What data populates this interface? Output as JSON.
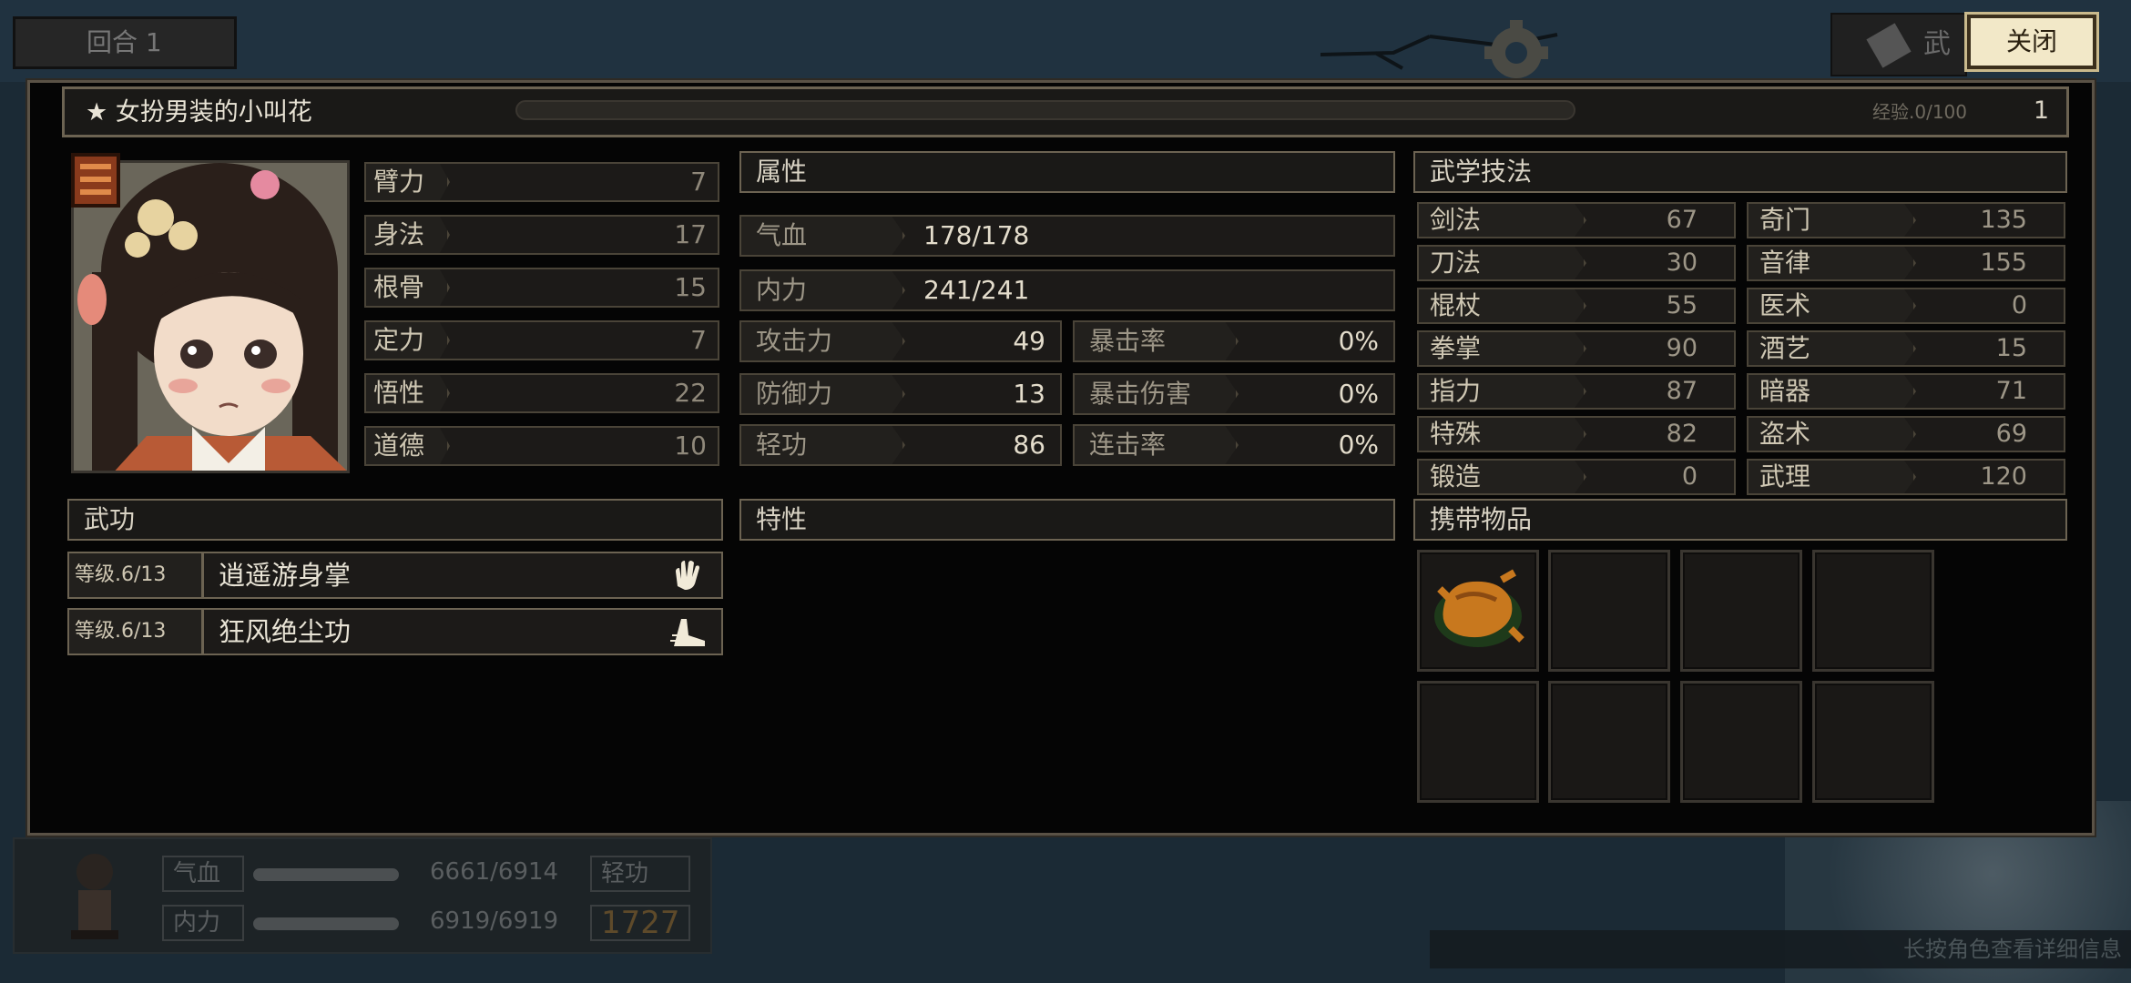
{
  "background": {
    "turn_label": "回合 1",
    "skill_button_label": "武工",
    "hint_text": "长按角色查看详细信息",
    "hud": {
      "hp_label": "气血",
      "hp_value": "6661/6914",
      "mp_label": "内力",
      "mp_value": "6919/6919",
      "qinggong_label": "轻功",
      "qinggong_value": "1727"
    }
  },
  "close_button": "关闭",
  "character": {
    "name": "★ 女扮男装的小叫花",
    "exp": "经验.0/100",
    "exp_progress": 0.0,
    "level": "1"
  },
  "base_stats": [
    {
      "label": "臂力",
      "value": "7"
    },
    {
      "label": "身法",
      "value": "17"
    },
    {
      "label": "根骨",
      "value": "15"
    },
    {
      "label": "定力",
      "value": "7"
    },
    {
      "label": "悟性",
      "value": "22"
    },
    {
      "label": "道德",
      "value": "10"
    }
  ],
  "attributes": {
    "title": "属性",
    "hp": {
      "label": "气血",
      "value": "178/178"
    },
    "mp": {
      "label": "内力",
      "value": "241/241"
    },
    "attack": {
      "label": "攻击力",
      "value": "49"
    },
    "crit_rate": {
      "label": "暴击率",
      "value": "0%"
    },
    "defense": {
      "label": "防御力",
      "value": "13"
    },
    "crit_damage": {
      "label": "暴击伤害",
      "value": "0%"
    },
    "qinggong": {
      "label": "轻功",
      "value": "86"
    },
    "combo_rate": {
      "label": "连击率",
      "value": "0%"
    }
  },
  "skills": {
    "title": "武学技法",
    "left": [
      {
        "label": "剑法",
        "value": "67"
      },
      {
        "label": "刀法",
        "value": "30"
      },
      {
        "label": "棍杖",
        "value": "55"
      },
      {
        "label": "拳掌",
        "value": "90"
      },
      {
        "label": "指力",
        "value": "87"
      },
      {
        "label": "特殊",
        "value": "82"
      },
      {
        "label": "锻造",
        "value": "0"
      }
    ],
    "right": [
      {
        "label": "奇门",
        "value": "135"
      },
      {
        "label": "音律",
        "value": "155"
      },
      {
        "label": "医术",
        "value": "0"
      },
      {
        "label": "酒艺",
        "value": "15"
      },
      {
        "label": "暗器",
        "value": "71"
      },
      {
        "label": "盗术",
        "value": "69"
      },
      {
        "label": "武理",
        "value": "120"
      }
    ]
  },
  "martial": {
    "title": "武功",
    "items": [
      {
        "level": "等级.6/13",
        "name": "逍遥游身掌",
        "icon": "palm-icon"
      },
      {
        "level": "等级.6/13",
        "name": "狂风绝尘功",
        "icon": "boot-icon"
      }
    ]
  },
  "traits": {
    "title": "特性"
  },
  "inventory": {
    "title": "携带物品",
    "slots": [
      "roast-chicken-icon",
      "",
      "",
      "",
      "",
      "",
      "",
      ""
    ]
  }
}
